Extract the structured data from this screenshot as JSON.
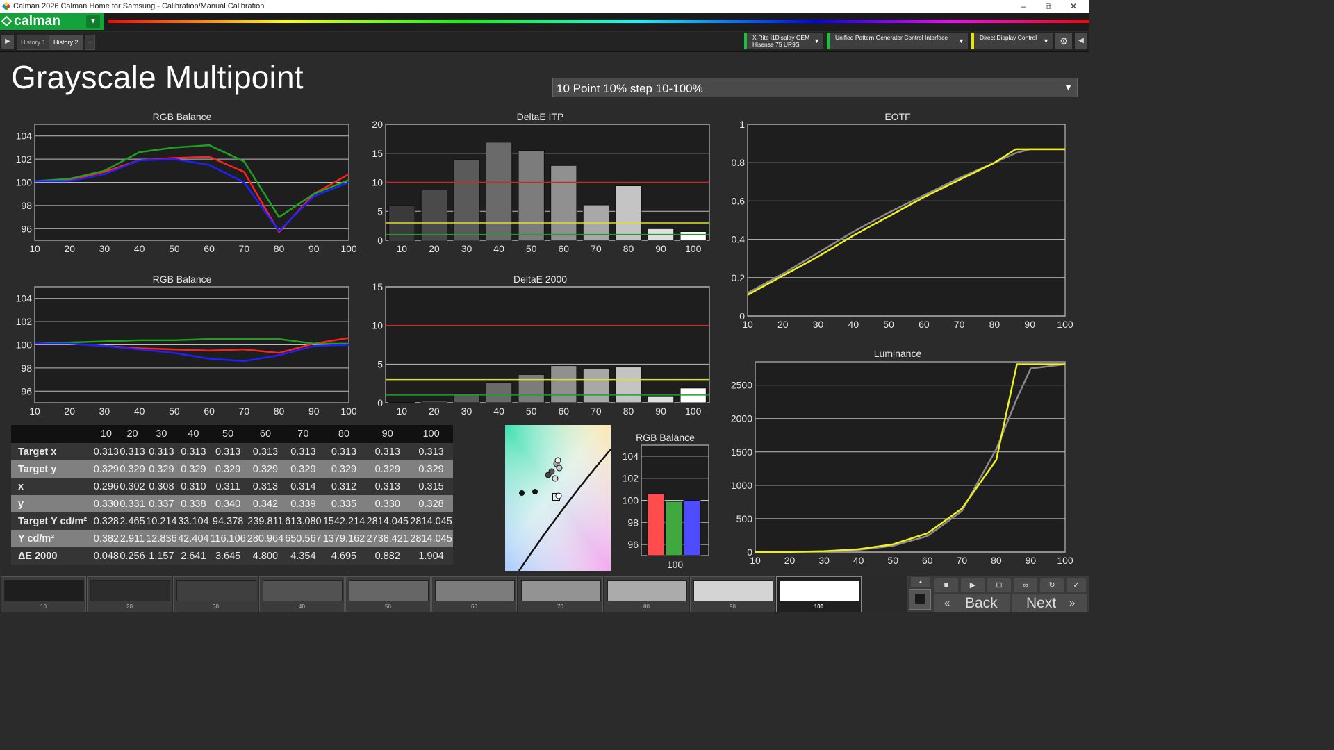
{
  "window": {
    "title": "Calman 2026 Calman Home for Samsung  - Calibration/Manual Calibration",
    "minimize": "–",
    "maximize": "⧉",
    "close": "✕"
  },
  "brand": {
    "name": "calman",
    "dropdown": "▾"
  },
  "tabs": [
    {
      "label": "History 1"
    },
    {
      "label": "History 2"
    }
  ],
  "add_tab": "+",
  "devices": [
    {
      "line1": "X-Rite i1Display OEM",
      "line2": "Hisense 75 UR9S"
    },
    {
      "line1": "Unified Pattern Generator Control Interface",
      "line2": ""
    },
    {
      "line1": "Direct Display Control",
      "line2": ""
    }
  ],
  "page_title": "Grayscale Multipoint",
  "preset": {
    "value": "10 Point 10% step 10-100%"
  },
  "charts_text": {
    "rgb_balance_1": "RGB Balance",
    "deltae_itp": "DeltaE ITP",
    "eotf": "EOTF",
    "rgb_balance_2": "RGB Balance",
    "deltae_2000": "DeltaE 2000",
    "luminance": "Luminance",
    "rgb_balance_bar": "RGB Balance"
  },
  "chart_data": [
    {
      "id": "rgb1",
      "type": "line",
      "title": "RGB Balance",
      "x": [
        10,
        20,
        30,
        40,
        50,
        60,
        70,
        80,
        90,
        100
      ],
      "ylim": [
        95,
        105
      ],
      "yticks": [
        96,
        98,
        100,
        102,
        104
      ],
      "series": [
        {
          "color": "#ff2020",
          "values": [
            100.1,
            100.2,
            100.9,
            101.9,
            102.1,
            102.2,
            100.9,
            95.7,
            99.0,
            100.7
          ]
        },
        {
          "color": "#20a020",
          "values": [
            100.1,
            100.3,
            101.0,
            102.6,
            103.0,
            103.2,
            101.8,
            97.0,
            99.0,
            100.2
          ]
        },
        {
          "color": "#2020ff",
          "values": [
            100.1,
            100.1,
            100.7,
            101.9,
            102.0,
            101.5,
            100.0,
            95.8,
            98.8,
            100.0
          ]
        }
      ]
    },
    {
      "id": "itp",
      "type": "bar",
      "title": "DeltaE ITP",
      "categories": [
        "10",
        "20",
        "30",
        "40",
        "50",
        "60",
        "70",
        "80",
        "90",
        "100"
      ],
      "values": [
        6.0,
        8.7,
        13.9,
        16.9,
        15.5,
        12.9,
        6.1,
        9.4,
        2.0,
        1.5
      ],
      "ylim": [
        0,
        20
      ],
      "yticks": [
        0,
        5,
        10,
        15,
        20
      ],
      "thresholds": [
        10,
        3,
        1
      ]
    },
    {
      "id": "eotf",
      "type": "line",
      "title": "EOTF",
      "x": [
        10,
        20,
        30,
        40,
        50,
        60,
        70,
        80,
        86,
        90,
        100
      ],
      "ylim": [
        0,
        1
      ],
      "yticks": [
        0,
        0.2,
        0.4,
        0.6,
        0.8,
        1
      ],
      "yticklabels": [
        "0",
        "0.2",
        "0.4",
        "0.6",
        "0.8",
        "1"
      ],
      "series": [
        {
          "color": "#8a8a8a",
          "values": [
            0.12,
            0.22,
            0.33,
            0.44,
            0.54,
            0.63,
            0.72,
            0.8,
            0.85,
            0.87,
            0.87
          ]
        },
        {
          "color": "#f0f020",
          "values": [
            0.11,
            0.21,
            0.31,
            0.42,
            0.52,
            0.62,
            0.71,
            0.8,
            0.87,
            0.87,
            0.87
          ]
        }
      ]
    },
    {
      "id": "rgb2",
      "type": "line",
      "title": "RGB Balance",
      "x": [
        10,
        20,
        30,
        40,
        50,
        60,
        70,
        80,
        90,
        100
      ],
      "ylim": [
        95,
        105
      ],
      "yticks": [
        96,
        98,
        100,
        102,
        104
      ],
      "series": [
        {
          "color": "#ff2020",
          "values": [
            100.1,
            100.1,
            99.9,
            99.7,
            99.6,
            99.5,
            99.6,
            99.3,
            100.1,
            100.6
          ]
        },
        {
          "color": "#20a020",
          "values": [
            100.1,
            100.2,
            100.3,
            100.4,
            100.4,
            100.5,
            100.5,
            100.5,
            100.1,
            100.1
          ]
        },
        {
          "color": "#2020ff",
          "values": [
            100.1,
            100.1,
            99.9,
            99.6,
            99.3,
            98.8,
            98.6,
            99.1,
            99.9,
            100.0
          ]
        }
      ]
    },
    {
      "id": "de2000",
      "type": "bar",
      "title": "DeltaE 2000",
      "categories": [
        "10",
        "20",
        "30",
        "40",
        "50",
        "60",
        "70",
        "80",
        "90",
        "100"
      ],
      "values": [
        0.048,
        0.256,
        1.157,
        2.641,
        3.645,
        4.8,
        4.354,
        4.695,
        0.882,
        1.904
      ],
      "ylim": [
        0,
        15
      ],
      "yticks": [
        0,
        5,
        10,
        15
      ],
      "thresholds": [
        10,
        3,
        1
      ]
    },
    {
      "id": "lum",
      "type": "line",
      "title": "Luminance",
      "x": [
        10,
        20,
        30,
        40,
        50,
        60,
        70,
        80,
        86,
        90,
        100
      ],
      "ylim": [
        0,
        2850
      ],
      "yticks": [
        0,
        500,
        1000,
        1500,
        2000,
        2500
      ],
      "series": [
        {
          "color": "#8a8a8a",
          "values": [
            0.328,
            2.465,
            10.214,
            33.104,
            94.378,
            239.811,
            613.08,
            1542.214,
            2300,
            2750,
            2814.045
          ]
        },
        {
          "color": "#f0f020",
          "values": [
            0.382,
            2.911,
            12.836,
            42.404,
            116.106,
            280.964,
            650.567,
            1379.162,
            2814.045,
            2814.045,
            2814.045
          ]
        }
      ]
    },
    {
      "id": "rgbbar",
      "type": "bar",
      "title": "RGB Balance",
      "categories": [
        "100"
      ],
      "series": [
        {
          "color": "#ff4d4d",
          "value": 100.6
        },
        {
          "color": "#3fa83f",
          "value": 99.9
        },
        {
          "color": "#4d4dff",
          "value": 100.0
        }
      ],
      "ylim": [
        95,
        105
      ],
      "yticks": [
        96,
        98,
        100,
        102,
        104
      ]
    }
  ],
  "table": {
    "columns": [
      "10",
      "20",
      "30",
      "40",
      "50",
      "60",
      "70",
      "80",
      "90",
      "100"
    ],
    "rows": [
      {
        "label": "Target x",
        "values": [
          "0.313",
          "0.313",
          "0.313",
          "0.313",
          "0.313",
          "0.313",
          "0.313",
          "0.313",
          "0.313",
          "0.313"
        ]
      },
      {
        "label": "Target y",
        "values": [
          "0.329",
          "0.329",
          "0.329",
          "0.329",
          "0.329",
          "0.329",
          "0.329",
          "0.329",
          "0.329",
          "0.329"
        ]
      },
      {
        "label": "x",
        "values": [
          "0.296",
          "0.302",
          "0.308",
          "0.310",
          "0.311",
          "0.313",
          "0.314",
          "0.312",
          "0.313",
          "0.315"
        ]
      },
      {
        "label": "y",
        "values": [
          "0.330",
          "0.331",
          "0.337",
          "0.338",
          "0.340",
          "0.342",
          "0.339",
          "0.335",
          "0.330",
          "0.328"
        ]
      },
      {
        "label": "Target Y cd/m²",
        "values": [
          "0.328",
          "2.465",
          "10.214",
          "33.104",
          "94.378",
          "239.811",
          "613.080",
          "1542.214",
          "2814.045",
          "2814.045"
        ]
      },
      {
        "label": "Y cd/m²",
        "values": [
          "0.382",
          "2.911",
          "12.836",
          "42.404",
          "116.106",
          "280.964",
          "650.567",
          "1379.162",
          "2738.421",
          "2814.045"
        ]
      },
      {
        "label": "ΔE 2000",
        "values": [
          "0.048",
          "0.256",
          "1.157",
          "2.641",
          "3.645",
          "4.800",
          "4.354",
          "4.695",
          "0.882",
          "1.904"
        ]
      }
    ]
  },
  "swatches": [
    {
      "label": "10",
      "color": "#1e1e1e"
    },
    {
      "label": "20",
      "color": "#2c2c2c"
    },
    {
      "label": "30",
      "color": "#3f3f3f"
    },
    {
      "label": "40",
      "color": "#525252"
    },
    {
      "label": "50",
      "color": "#666666"
    },
    {
      "label": "60",
      "color": "#7c7c7c"
    },
    {
      "label": "70",
      "color": "#939393"
    },
    {
      "label": "80",
      "color": "#ababab"
    },
    {
      "label": "90",
      "color": "#d4d4d4"
    },
    {
      "label": "100",
      "color": "#ffffff"
    }
  ],
  "nav": {
    "back": "Back",
    "next": "Next"
  }
}
